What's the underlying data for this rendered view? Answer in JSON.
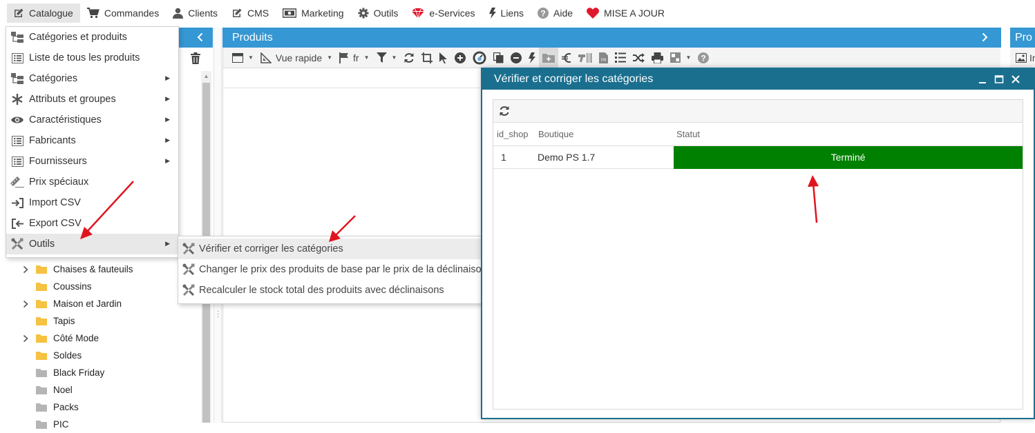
{
  "topbar": {
    "items": [
      {
        "label": "Catalogue",
        "icon": "edit-icon"
      },
      {
        "label": "Commandes",
        "icon": "cart-icon"
      },
      {
        "label": "Clients",
        "icon": "user-icon"
      },
      {
        "label": "CMS",
        "icon": "edit-icon"
      },
      {
        "label": "Marketing",
        "icon": "banknote-icon"
      },
      {
        "label": "Outils",
        "icon": "gear-icon"
      },
      {
        "label": "e-Services",
        "icon": "gem-icon"
      },
      {
        "label": "Liens",
        "icon": "bolt-icon"
      },
      {
        "label": "Aide",
        "icon": "help-icon"
      },
      {
        "label": "MISE A JOUR",
        "icon": "heart-icon"
      }
    ],
    "active": "Catalogue"
  },
  "catalogue_menu": {
    "items": [
      {
        "label": "Catégories et produits",
        "icon": "tree-icon",
        "submenu": false
      },
      {
        "label": "Liste de tous les produits",
        "icon": "list-icon",
        "submenu": false
      },
      {
        "label": "Catégories",
        "icon": "tree-icon",
        "submenu": true
      },
      {
        "label": "Attributs et groupes",
        "icon": "asterisk-icon",
        "submenu": true
      },
      {
        "label": "Caractéristiques",
        "icon": "eye-icon",
        "submenu": true
      },
      {
        "label": "Fabricants",
        "icon": "list-icon",
        "submenu": true
      },
      {
        "label": "Fournisseurs",
        "icon": "list-icon",
        "submenu": true
      },
      {
        "label": "Prix spéciaux",
        "icon": "ruler-icon",
        "submenu": false
      },
      {
        "label": "Import CSV",
        "icon": "sign-in-icon",
        "submenu": false
      },
      {
        "label": "Export CSV",
        "icon": "sign-out-icon",
        "submenu": false
      },
      {
        "label": "Outils",
        "icon": "tools-icon",
        "submenu": true
      }
    ],
    "active": "Outils"
  },
  "tools_submenu": {
    "items": [
      {
        "label": "Vérifier et corriger les catégories"
      },
      {
        "label": "Changer le prix des produits de base par le prix de la déclinaison par défaut"
      },
      {
        "label": "Recalculer le stock total des produits avec déclinaisons"
      }
    ],
    "hovered": 0
  },
  "category_tree": [
    {
      "label": "Chaises & fauteuils",
      "expandable": true,
      "folder_color": "#f5c242"
    },
    {
      "label": "Coussins",
      "expandable": false,
      "folder_color": "#f5c242"
    },
    {
      "label": "Maison et Jardin",
      "expandable": true,
      "folder_color": "#f5c242"
    },
    {
      "label": "Tapis",
      "expandable": false,
      "folder_color": "#f5c242"
    },
    {
      "label": "Côté Mode",
      "expandable": true,
      "folder_color": "#f5c242"
    },
    {
      "label": "Soldes",
      "expandable": false,
      "folder_color": "#f5c242"
    },
    {
      "label": "Black Friday",
      "expandable": false,
      "folder_color": "#b5b5b5"
    },
    {
      "label": "Noel",
      "expandable": false,
      "folder_color": "#b5b5b5"
    },
    {
      "label": "Packs",
      "expandable": false,
      "folder_color": "#b5b5b5"
    },
    {
      "label": "PIC",
      "expandable": false,
      "folder_color": "#b5b5b5"
    }
  ],
  "products_panel": {
    "title": "Produits",
    "toolbar": {
      "view_label": "Vue rapide",
      "lang_label": "fr"
    }
  },
  "right_panel": {
    "title": "Pro",
    "toolbar_label": "Im"
  },
  "dialog": {
    "title": "Vérifier et corriger les catégories",
    "columns": [
      "id_shop",
      "Boutique",
      "Statut"
    ],
    "rows": [
      {
        "id_shop": "1",
        "boutique": "Demo PS 1.7",
        "statut": "Terminé"
      }
    ],
    "status_color": "#008000"
  },
  "colors": {
    "panel_header": "#3597d3",
    "dialog_title": "#1a6f8f",
    "annotation_arrow": "#e0141e"
  }
}
